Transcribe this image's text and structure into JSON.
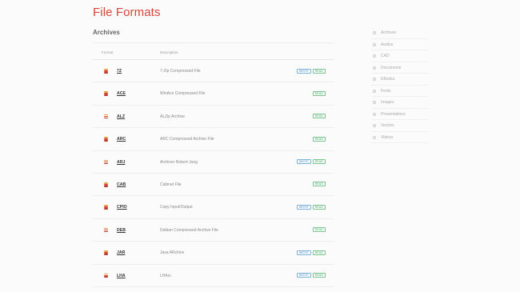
{
  "page": {
    "title": "File Formats"
  },
  "section": {
    "title": "Archives"
  },
  "table": {
    "headers": {
      "format": "Format",
      "description": "Description"
    },
    "rows": [
      {
        "format": "7Z",
        "description": "7-Zip Compressed File",
        "badges": [
          "WRITE",
          "READ"
        ]
      },
      {
        "format": "ACE",
        "description": "WinAce Compressed File",
        "badges": [
          "READ"
        ]
      },
      {
        "format": "ALZ",
        "description": "ALZip Archive",
        "badges": [
          "READ"
        ]
      },
      {
        "format": "ARC",
        "description": "ARC Compressed Archive File",
        "badges": [
          "READ"
        ]
      },
      {
        "format": "ARJ",
        "description": "Archiver Robert Jung",
        "badges": [
          "WRITE",
          "READ"
        ]
      },
      {
        "format": "CAB",
        "description": "Cabinet File",
        "badges": [
          "READ"
        ]
      },
      {
        "format": "CPIO",
        "description": "Copy Input/Output",
        "badges": [
          "WRITE",
          "READ"
        ]
      },
      {
        "format": "DEB",
        "description": "Debian Compressed Archive File",
        "badges": [
          "READ"
        ]
      },
      {
        "format": "JAR",
        "description": "Java ARchive",
        "badges": [
          "WRITE",
          "READ"
        ]
      },
      {
        "format": "LHA",
        "description": "LHArc",
        "badges": [
          "WRITE",
          "READ"
        ]
      }
    ]
  },
  "sidebar": {
    "items": [
      {
        "label": "Archives"
      },
      {
        "label": "Audios"
      },
      {
        "label": "CAD"
      },
      {
        "label": "Documents"
      },
      {
        "label": "EBooks"
      },
      {
        "label": "Fonts"
      },
      {
        "label": "Images"
      },
      {
        "label": "Presentations"
      },
      {
        "label": "Vectors"
      },
      {
        "label": "Videos"
      }
    ]
  },
  "colors": {
    "accent": "#d9443a",
    "write_badge": "#4a8ec2",
    "read_badge": "#3da55c"
  },
  "icons": {
    "format_icon": "layers-stack-icon",
    "sidebar_bullet": "circle-bullet-icon"
  }
}
